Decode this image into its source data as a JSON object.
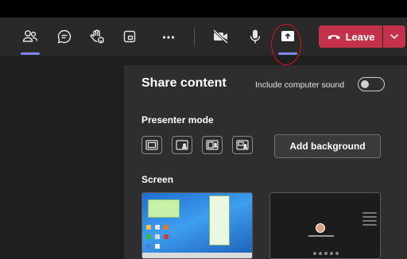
{
  "toolbar": {
    "items": [
      "people-icon",
      "chat-icon",
      "raise-hand-icon",
      "view-icon",
      "more-icon",
      "camera-off-icon",
      "mic-icon",
      "share-icon"
    ],
    "leave_label": "Leave",
    "accent": "#7f85f5",
    "leave_color": "#c4314b"
  },
  "share_panel": {
    "title": "Share content",
    "include_sound_label": "Include computer sound",
    "include_sound_on": false,
    "presenter_mode_label": "Presenter mode",
    "presenter_modes": [
      "content-only-icon",
      "standout-icon",
      "side-by-side-icon",
      "reporter-icon"
    ],
    "add_background_label": "Add background",
    "screen_label": "Screen",
    "screens": [
      "screen-1-thumbnail",
      "screen-2-thumbnail"
    ]
  }
}
